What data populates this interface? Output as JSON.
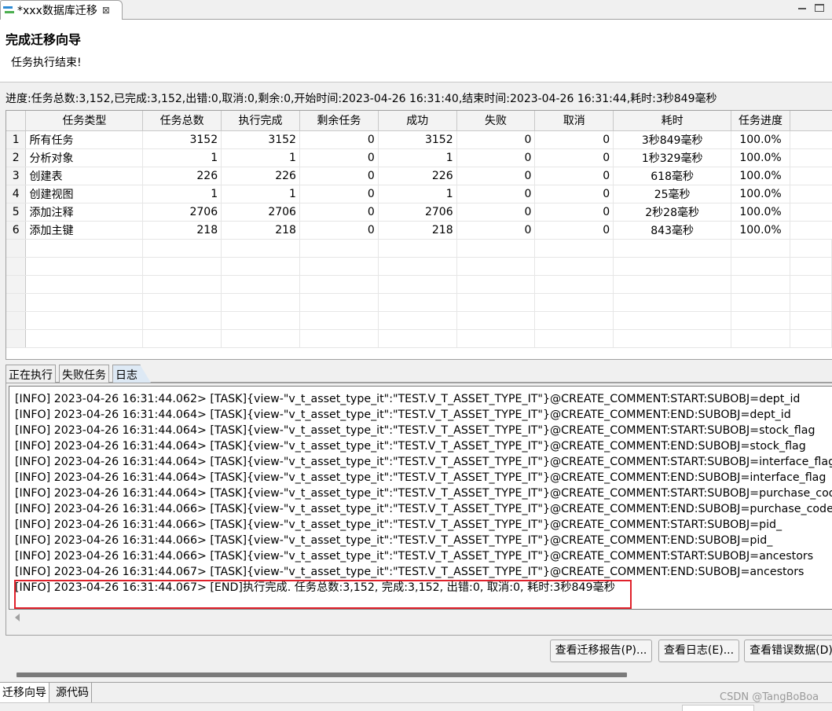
{
  "editor_tab": {
    "title": "*xxx数据库迁移",
    "close": "⊠"
  },
  "header": {
    "title": "完成迁移向导",
    "subtitle": "任务执行结束!"
  },
  "progress_text": "进度:任务总数:3,152,已完成:3,152,出错:0,取消:0,剩余:0,开始时间:2023-04-26 16:31:40,结束时间:2023-04-26 16:31:44,耗时:3秒849毫秒",
  "table": {
    "columns": [
      "任务类型",
      "任务总数",
      "执行完成",
      "剩余任务",
      "成功",
      "失败",
      "取消",
      "耗时",
      "任务进度"
    ],
    "rows": [
      {
        "n": "1",
        "type": "所有任务",
        "total": "3152",
        "done": "3152",
        "remain": "0",
        "success": "3152",
        "fail": "0",
        "cancel": "0",
        "time": "3秒849毫秒",
        "progress": "100.0%"
      },
      {
        "n": "2",
        "type": "分析对象",
        "total": "1",
        "done": "1",
        "remain": "0",
        "success": "1",
        "fail": "0",
        "cancel": "0",
        "time": "1秒329毫秒",
        "progress": "100.0%"
      },
      {
        "n": "3",
        "type": "创建表",
        "total": "226",
        "done": "226",
        "remain": "0",
        "success": "226",
        "fail": "0",
        "cancel": "0",
        "time": "618毫秒",
        "progress": "100.0%"
      },
      {
        "n": "4",
        "type": "创建视图",
        "total": "1",
        "done": "1",
        "remain": "0",
        "success": "1",
        "fail": "0",
        "cancel": "0",
        "time": "25毫秒",
        "progress": "100.0%"
      },
      {
        "n": "5",
        "type": "添加注释",
        "total": "2706",
        "done": "2706",
        "remain": "0",
        "success": "2706",
        "fail": "0",
        "cancel": "0",
        "time": "2秒28毫秒",
        "progress": "100.0%"
      },
      {
        "n": "6",
        "type": "添加主键",
        "total": "218",
        "done": "218",
        "remain": "0",
        "success": "218",
        "fail": "0",
        "cancel": "0",
        "time": "843毫秒",
        "progress": "100.0%"
      }
    ]
  },
  "subtabs": [
    "正在执行",
    "失败任务",
    "日志"
  ],
  "log_lines": [
    "[INFO] 2023-04-26 16:31:44.062> [TASK]{view-\"v_t_asset_type_it\":\"TEST.V_T_ASSET_TYPE_IT\"}@CREATE_COMMENT:START:SUBOBJ=dept_id",
    "[INFO] 2023-04-26 16:31:44.064> [TASK]{view-\"v_t_asset_type_it\":\"TEST.V_T_ASSET_TYPE_IT\"}@CREATE_COMMENT:END:SUBOBJ=dept_id",
    "[INFO] 2023-04-26 16:31:44.064> [TASK]{view-\"v_t_asset_type_it\":\"TEST.V_T_ASSET_TYPE_IT\"}@CREATE_COMMENT:START:SUBOBJ=stock_flag",
    "[INFO] 2023-04-26 16:31:44.064> [TASK]{view-\"v_t_asset_type_it\":\"TEST.V_T_ASSET_TYPE_IT\"}@CREATE_COMMENT:END:SUBOBJ=stock_flag",
    "[INFO] 2023-04-26 16:31:44.064> [TASK]{view-\"v_t_asset_type_it\":\"TEST.V_T_ASSET_TYPE_IT\"}@CREATE_COMMENT:START:SUBOBJ=interface_flag",
    "[INFO] 2023-04-26 16:31:44.064> [TASK]{view-\"v_t_asset_type_it\":\"TEST.V_T_ASSET_TYPE_IT\"}@CREATE_COMMENT:END:SUBOBJ=interface_flag",
    "[INFO] 2023-04-26 16:31:44.064> [TASK]{view-\"v_t_asset_type_it\":\"TEST.V_T_ASSET_TYPE_IT\"}@CREATE_COMMENT:START:SUBOBJ=purchase_code",
    "[INFO] 2023-04-26 16:31:44.066> [TASK]{view-\"v_t_asset_type_it\":\"TEST.V_T_ASSET_TYPE_IT\"}@CREATE_COMMENT:END:SUBOBJ=purchase_code",
    "[INFO] 2023-04-26 16:31:44.066> [TASK]{view-\"v_t_asset_type_it\":\"TEST.V_T_ASSET_TYPE_IT\"}@CREATE_COMMENT:START:SUBOBJ=pid_",
    "[INFO] 2023-04-26 16:31:44.066> [TASK]{view-\"v_t_asset_type_it\":\"TEST.V_T_ASSET_TYPE_IT\"}@CREATE_COMMENT:END:SUBOBJ=pid_",
    "[INFO] 2023-04-26 16:31:44.066> [TASK]{view-\"v_t_asset_type_it\":\"TEST.V_T_ASSET_TYPE_IT\"}@CREATE_COMMENT:START:SUBOBJ=ancestors",
    "[INFO] 2023-04-26 16:31:44.067> [TASK]{view-\"v_t_asset_type_it\":\"TEST.V_T_ASSET_TYPE_IT\"}@CREATE_COMMENT:END:SUBOBJ=ancestors",
    "[INFO] 2023-04-26 16:31:44.067> [END]执行完成. 任务总数:3,152, 完成:3,152, 出错:0, 取消:0, 耗时:3秒849毫秒"
  ],
  "buttons": {
    "report": "查看迁移报告(P)...",
    "log": "查看日志(E)...",
    "error": "查看错误数据(D)"
  },
  "bottom_tabs": [
    "迁移向导",
    "源代码"
  ],
  "watermark": "CSDN @TangBoBoa",
  "colors": {
    "highlight": "#e0212b",
    "active_tab": "#dde9f5"
  }
}
